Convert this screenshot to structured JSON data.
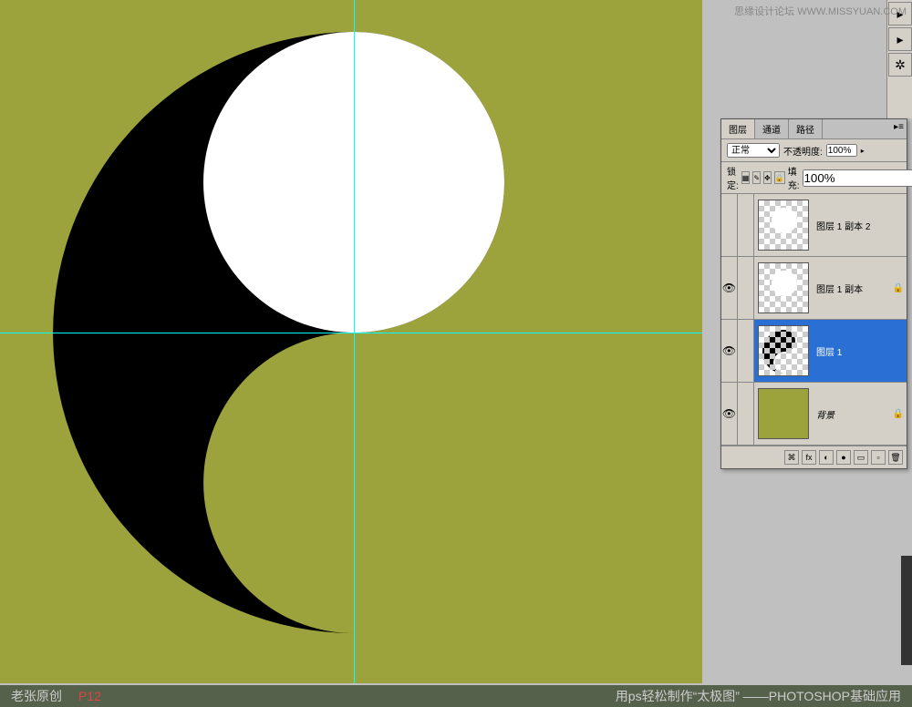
{
  "watermark": "思缘设计论坛  WWW.MISSYUAN.COM",
  "panel": {
    "tabs": [
      "图层",
      "通道",
      "路径"
    ],
    "blendMode": "正常",
    "opacityLabel": "不透明度:",
    "opacityValue": "100%",
    "lockLabel": "锁定:",
    "fillLabel": "填充:",
    "fillValue": "100%"
  },
  "layers": [
    {
      "name": "图层 1 副本 2",
      "visible": false,
      "locked": false
    },
    {
      "name": "图层 1 副本",
      "visible": true,
      "locked": false
    },
    {
      "name": "图层 1",
      "visible": true,
      "locked": false,
      "selected": true
    },
    {
      "name": "背景",
      "visible": true,
      "locked": true
    }
  ],
  "bottom": {
    "author": "老张原创",
    "page": "P12",
    "title": "用ps轻松制作“太极图” ——PHOTOSHOP基础应用"
  }
}
